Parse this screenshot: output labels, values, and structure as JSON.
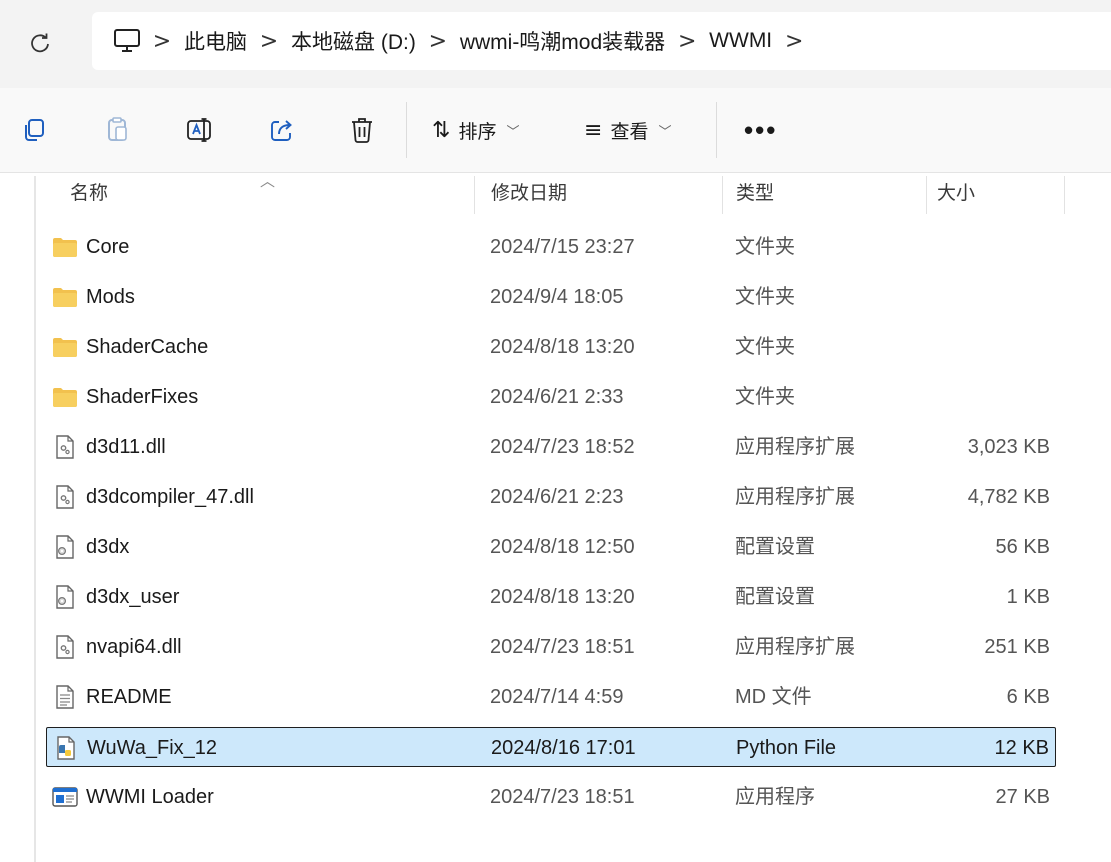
{
  "address_bar": {
    "breadcrumbs": [
      "此电脑",
      "本地磁盘 (D:)",
      "wwmi-鸣潮mod装载器",
      "WWMI"
    ],
    "separator": ">"
  },
  "command_bar": {
    "sort_label": "排序",
    "view_label": "查看",
    "more_label": "•••"
  },
  "columns": {
    "name": "名称",
    "date": "修改日期",
    "type": "类型",
    "size": "大小"
  },
  "files": [
    {
      "name": "Core",
      "date": "2024/7/15 23:27",
      "type": "文件夹",
      "size": "",
      "icon": "folder-icon"
    },
    {
      "name": "Mods",
      "date": "2024/9/4 18:05",
      "type": "文件夹",
      "size": "",
      "icon": "folder-icon"
    },
    {
      "name": "ShaderCache",
      "date": "2024/8/18 13:20",
      "type": "文件夹",
      "size": "",
      "icon": "folder-icon"
    },
    {
      "name": "ShaderFixes",
      "date": "2024/6/21 2:33",
      "type": "文件夹",
      "size": "",
      "icon": "folder-icon"
    },
    {
      "name": "d3d11.dll",
      "date": "2024/7/23 18:52",
      "type": "应用程序扩展",
      "size": "3,023 KB",
      "icon": "dll-file-icon"
    },
    {
      "name": "d3dcompiler_47.dll",
      "date": "2024/6/21 2:23",
      "type": "应用程序扩展",
      "size": "4,782 KB",
      "icon": "dll-file-icon"
    },
    {
      "name": "d3dx",
      "date": "2024/8/18 12:50",
      "type": "配置设置",
      "size": "56 KB",
      "icon": "config-file-icon"
    },
    {
      "name": "d3dx_user",
      "date": "2024/8/18 13:20",
      "type": "配置设置",
      "size": "1 KB",
      "icon": "config-file-icon"
    },
    {
      "name": "nvapi64.dll",
      "date": "2024/7/23 18:51",
      "type": "应用程序扩展",
      "size": "251 KB",
      "icon": "dll-file-icon"
    },
    {
      "name": "README",
      "date": "2024/7/14 4:59",
      "type": "MD 文件",
      "size": "6 KB",
      "icon": "text-file-icon"
    },
    {
      "name": "WuWa_Fix_12",
      "date": "2024/8/16 17:01",
      "type": "Python File",
      "size": "12 KB",
      "icon": "python-file-icon",
      "selected": true
    },
    {
      "name": "WWMI Loader",
      "date": "2024/7/23 18:51",
      "type": "应用程序",
      "size": "27 KB",
      "icon": "application-icon"
    }
  ],
  "colors": {
    "folder": "#f2c14e",
    "selection": "#cde8fb",
    "python_blue": "#3a76b0",
    "python_yellow": "#f5c93b",
    "app_blue": "#1f6fd1"
  }
}
